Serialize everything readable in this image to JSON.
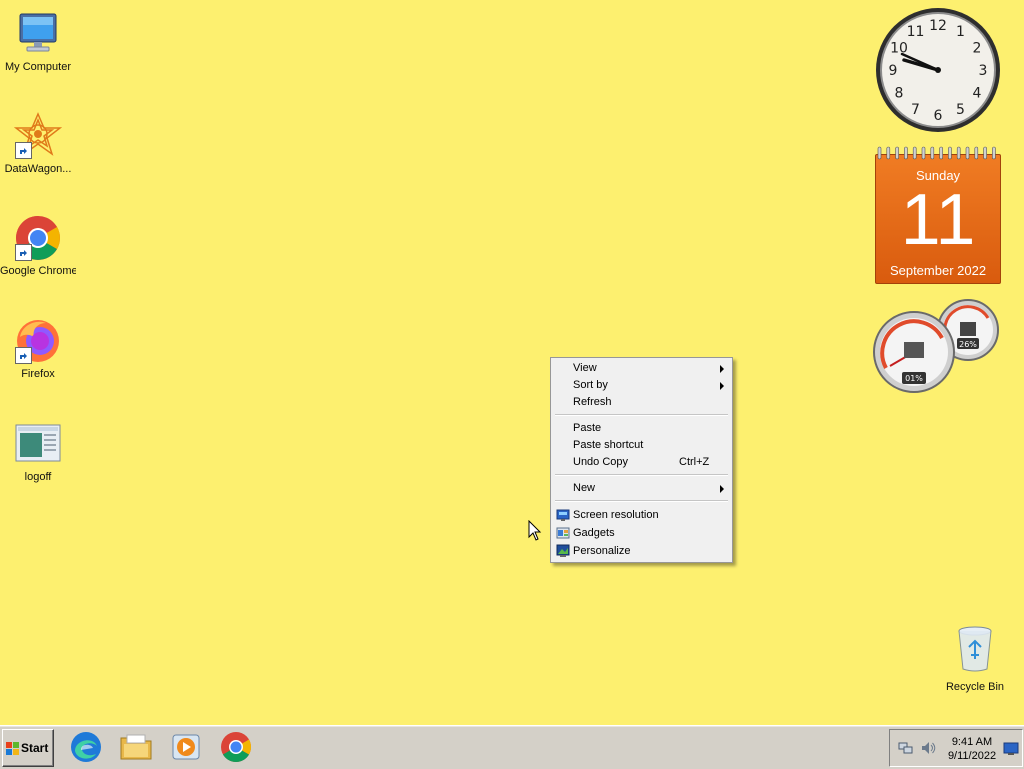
{
  "desktop": {
    "icons": [
      {
        "label": "My Computer"
      },
      {
        "label": "DataWagon..."
      },
      {
        "label": "Google Chrome"
      },
      {
        "label": "Firefox"
      },
      {
        "label": "logoff"
      }
    ],
    "recycle_bin": {
      "label": "Recycle Bin"
    }
  },
  "gadgets": {
    "clock": {
      "numerals": [
        "12",
        "1",
        "2",
        "3",
        "4",
        "5",
        "6",
        "7",
        "8",
        "9",
        "10",
        "11"
      ]
    },
    "calendar": {
      "weekday": "Sunday",
      "day": "11",
      "month_year": "September 2022"
    },
    "cpu_meter": {
      "cpu": "01%",
      "memory": "26%"
    }
  },
  "context_menu": {
    "items": [
      {
        "label": "View",
        "submenu": true
      },
      {
        "label": "Sort by",
        "submenu": true
      },
      {
        "label": "Refresh"
      },
      {
        "label": "Paste"
      },
      {
        "label": "Paste shortcut"
      },
      {
        "label": "Undo Copy",
        "shortcut": "Ctrl+Z"
      },
      {
        "label": "New",
        "submenu": true
      },
      {
        "label": "Screen resolution",
        "icon": "screen-resolution-icon"
      },
      {
        "label": "Gadgets",
        "icon": "gadgets-icon"
      },
      {
        "label": "Personalize",
        "icon": "personalize-icon"
      }
    ]
  },
  "taskbar": {
    "start_label": "Start",
    "pinned": [
      "edge-icon",
      "file-explorer-icon",
      "media-player-icon",
      "chrome-icon"
    ],
    "clock": {
      "time": "9:41 AM",
      "date": "9/11/2022"
    }
  }
}
